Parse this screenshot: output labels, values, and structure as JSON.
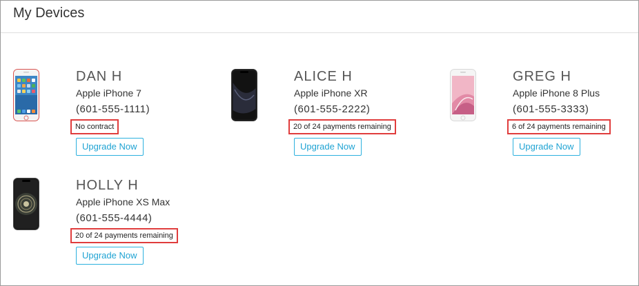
{
  "page_title": "My Devices",
  "devices": [
    {
      "name": "DAN H",
      "model": "Apple iPhone 7",
      "phone": "(601-555-1111)",
      "status": "No contract",
      "button": "Upgrade Now",
      "image_icon": "iphone-7-red-icon"
    },
    {
      "name": "ALICE H",
      "model": "Apple iPhone XR",
      "phone": "(601-555-2222)",
      "status": "20 of 24 payments remaining",
      "button": "Upgrade Now",
      "image_icon": "iphone-xr-black-icon"
    },
    {
      "name": "GREG H",
      "model": "Apple iPhone 8 Plus",
      "phone": "(601-555-3333)",
      "status": "6 of 24 payments remaining",
      "button": "Upgrade Now",
      "image_icon": "iphone-8-plus-silver-icon"
    },
    {
      "name": "HOLLY H",
      "model": "Apple iPhone XS Max",
      "phone": "(601-555-4444)",
      "status": "20 of 24 payments remaining",
      "button": "Upgrade Now",
      "image_icon": "iphone-xs-max-icon"
    }
  ],
  "colors": {
    "accent": "#2bb0de",
    "highlight_border": "#e03c3c",
    "frame_border": "#9a9a9a"
  }
}
